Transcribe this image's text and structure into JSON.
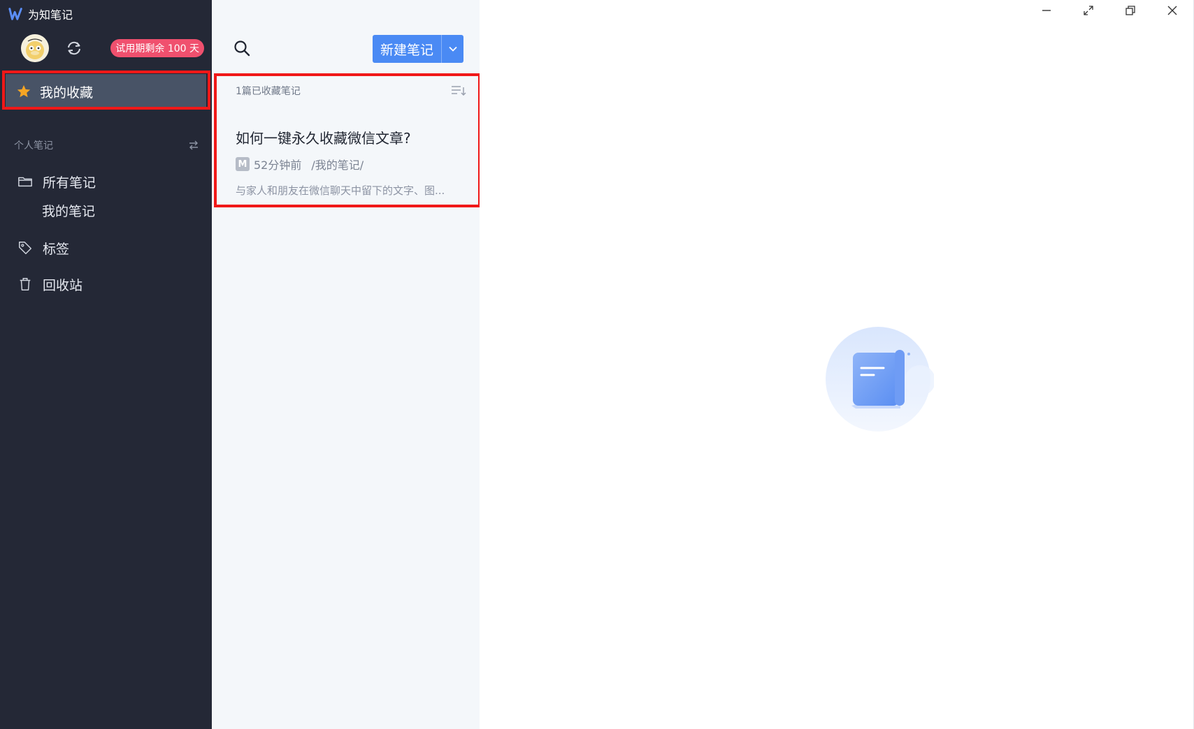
{
  "app": {
    "title": "为知笔记"
  },
  "user": {
    "trial_badge": "试用期剩余 100 天"
  },
  "sidebar": {
    "favorites_label": "我的收藏",
    "section_label": "个人笔记",
    "items": [
      {
        "label": "所有笔记",
        "icon": "folder-icon"
      },
      {
        "label": "我的笔记",
        "icon": ""
      },
      {
        "label": "标签",
        "icon": "tag-icon"
      },
      {
        "label": "回收站",
        "icon": "trash-icon"
      }
    ]
  },
  "list": {
    "new_note_label": "新建笔记",
    "header": "1篇已收藏笔记",
    "notes": [
      {
        "title": "如何一键永久收藏微信文章?",
        "badge": "M",
        "time": "52分钟前",
        "path": "/我的笔记/",
        "snippet": "与家人和朋友在微信聊天中留下的文字、图..."
      }
    ]
  },
  "colors": {
    "sidebar_bg": "#242836",
    "selected_bg": "#485366",
    "list_bg": "#f4f7fa",
    "accent": "#4a8af4",
    "trial_badge": "#f0506e",
    "highlight": "#f01818",
    "star": "#f5a524"
  }
}
